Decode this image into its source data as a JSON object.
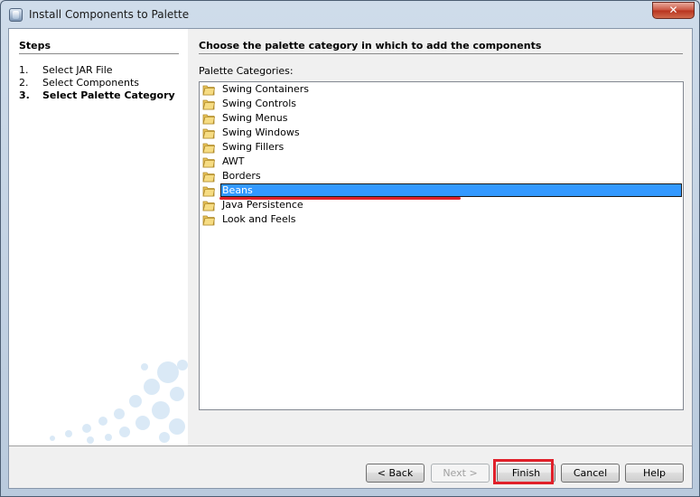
{
  "window": {
    "title": "Install Components to Palette",
    "close_glyph": "✕"
  },
  "steps": {
    "heading": "Steps",
    "items": [
      {
        "num": "1.",
        "label": "Select JAR File"
      },
      {
        "num": "2.",
        "label": "Select Components"
      },
      {
        "num": "3.",
        "label": "Select Palette Category"
      }
    ],
    "current_index": 2
  },
  "main": {
    "title": "Choose the palette category in which to add the components",
    "categories_label": "Palette Categories:",
    "categories": [
      "Swing Containers",
      "Swing Controls",
      "Swing Menus",
      "Swing Windows",
      "Swing Fillers",
      "AWT",
      "Borders",
      "Beans",
      "Java Persistence",
      "Look and Feels"
    ],
    "selected_category": "Beans"
  },
  "buttons": {
    "back": "< Back",
    "next": "Next >",
    "finish": "Finish",
    "cancel": "Cancel",
    "help": "Help"
  },
  "icons": {
    "window_icon": "app-window-icon",
    "folder_icon": "folder-icon",
    "close_icon": "close-icon"
  },
  "colors": {
    "selection": "#3399ff",
    "annotation_red": "#e0202a"
  }
}
